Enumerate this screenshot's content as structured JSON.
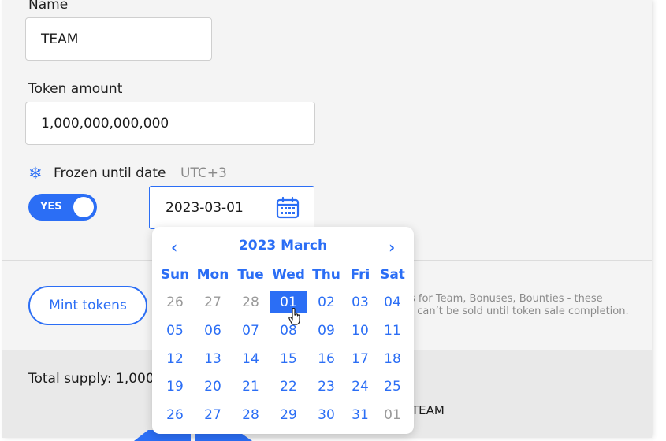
{
  "form": {
    "name_label": "Name",
    "name_value": "TEAM",
    "token_label": "Token amount",
    "token_value": "1,000,000,000,000",
    "frozen_label": "Frozen until date",
    "timezone": "UTC+3",
    "toggle_label": "YES",
    "date_value": "2023-03-01",
    "mint_label": "Mint tokens",
    "note_line1": "s for Team, Bonuses, Bounties - these",
    "note_line2": "t can’t be sold until token sale completion."
  },
  "calendar": {
    "title": "2023 March",
    "prev": "‹",
    "next": "›",
    "weekdays": [
      "Sun",
      "Mon",
      "Tue",
      "Wed",
      "Thu",
      "Fri",
      "Sat"
    ],
    "weeks": [
      [
        "26",
        "27",
        "28",
        "01",
        "02",
        "03",
        "04"
      ],
      [
        "05",
        "06",
        "07",
        "08",
        "09",
        "10",
        "11"
      ],
      [
        "12",
        "13",
        "14",
        "15",
        "16",
        "17",
        "18"
      ],
      [
        "19",
        "20",
        "21",
        "22",
        "23",
        "24",
        "25"
      ],
      [
        "26",
        "27",
        "28",
        "29",
        "30",
        "31",
        "01"
      ]
    ],
    "selected": "01"
  },
  "summary": {
    "total_supply": "Total supply: 1,000",
    "legend_team": "TEAM"
  },
  "colors": {
    "accent": "#2b6ef5",
    "muted": "#9a9a9a"
  }
}
